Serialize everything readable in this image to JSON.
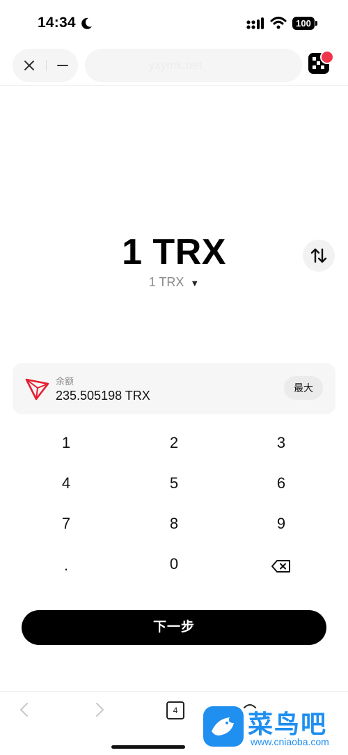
{
  "status_bar": {
    "time": "14:34",
    "battery": "100"
  },
  "browser": {
    "url": "yxymk.net"
  },
  "amount": {
    "main": "1 TRX",
    "secondary": "1  TRX"
  },
  "balance": {
    "label": "余额",
    "value": "235.505198  TRX",
    "max_label": "最大"
  },
  "keypad": {
    "keys": [
      "1",
      "2",
      "3",
      "4",
      "5",
      "6",
      "7",
      "8",
      "9",
      ".",
      "0"
    ],
    "backspace_icon": "backspace-icon"
  },
  "next_button": "下一步",
  "bottom_bar": {
    "tab_count": "4"
  },
  "watermark": {
    "title": "菜鸟吧",
    "url": "www.cniaoba.com"
  },
  "colors": {
    "tron_red": "#e51f2f",
    "badge": "#f0354b",
    "watermark": "#1f8ff0",
    "button": "#000000"
  }
}
